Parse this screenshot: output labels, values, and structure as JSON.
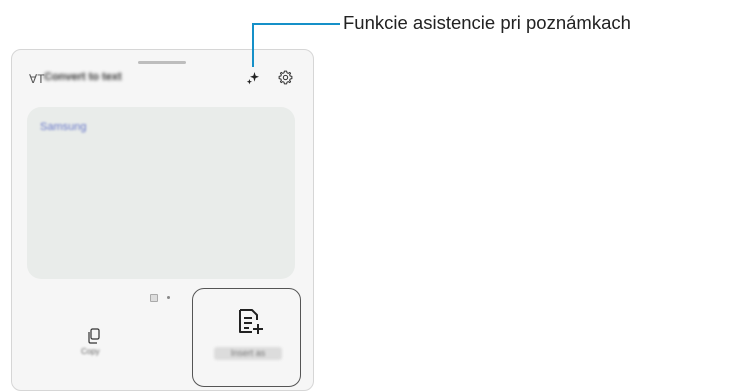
{
  "toolbar": {
    "title": "Convert to text",
    "icon": "handwriting-to-text-icon"
  },
  "note": {
    "text": "Samsung"
  },
  "bottom": {
    "copy_label": "Copy",
    "action_label": "Insert as"
  },
  "icons": {
    "assist": "sparkle-icon",
    "settings": "gear-icon",
    "copy": "copy-icon",
    "note": "note-add-icon"
  },
  "callout": {
    "label": "Funkcie asistencie pri poznámkach",
    "color": "#1590c8"
  }
}
